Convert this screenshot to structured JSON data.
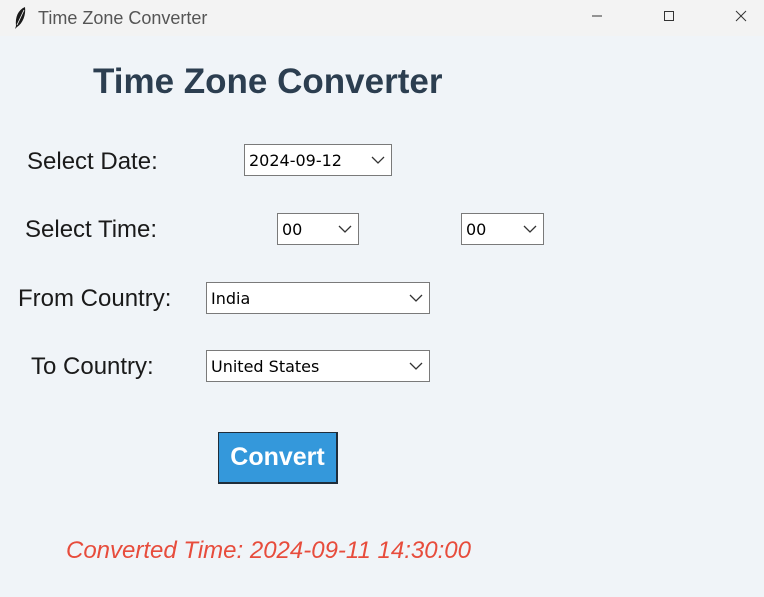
{
  "window": {
    "title": "Time Zone Converter",
    "icon": "feather-icon"
  },
  "heading": "Time Zone Converter",
  "form": {
    "date_label": "Select Date:",
    "date_value": "2024-09-12",
    "time_label": "Select Time:",
    "hour_value": "00",
    "minute_value": "00",
    "from_label": "From Country:",
    "from_value": "India",
    "to_label": "To Country:",
    "to_value": "United States"
  },
  "convert_label": "Convert",
  "result_text": "Converted Time: 2024-09-11 14:30:00",
  "colors": {
    "background": "#f0f4f8",
    "heading": "#2c3e50",
    "button": "#3498db",
    "result": "#e74c3c"
  }
}
